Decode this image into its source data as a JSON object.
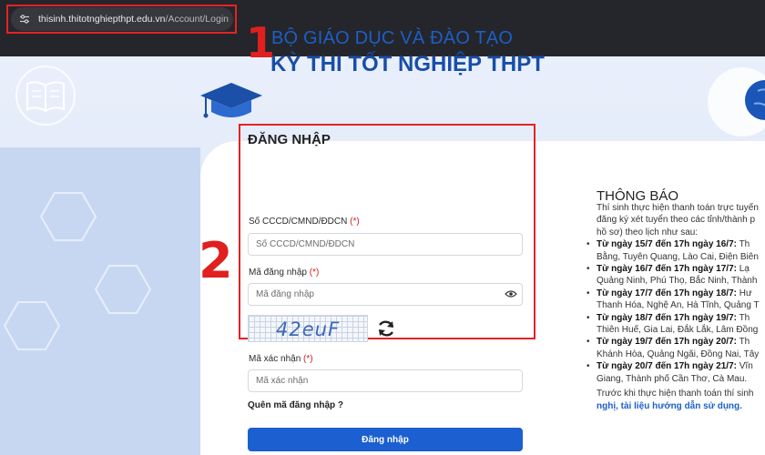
{
  "browser": {
    "url_host": "thisinh.thitotnghiepthpt.edu.vn",
    "url_path": "/Account/Login"
  },
  "annotations": {
    "step1": "1",
    "step2": "2"
  },
  "header": {
    "ministry": "BỘ GIÁO DỤC VÀ ĐÀO TẠO",
    "exam": "KỲ THI TỐT NGHIỆP THPT"
  },
  "login": {
    "title": "ĐĂNG NHẬP",
    "required_mark": "(*)",
    "id_label": "Số CCCD/CMND/ĐDCN",
    "id_placeholder": "Số CCCD/CMND/ĐDCN",
    "code_label": "Mã đăng nhập",
    "code_placeholder": "Mã đăng nhập",
    "captcha_text": "42euF",
    "captcha_label": "Mã xác nhận",
    "captcha_placeholder": "Mã xác nhận",
    "forgot": "Quên mã đăng nhập ?",
    "submit": "Đăng nhập"
  },
  "notice": {
    "title": "THÔNG BÁO",
    "intro": [
      "Thí sinh thực hiện thanh toán trực tuyến",
      "đăng ký xét tuyển theo các tỉnh/thành p",
      "hồ sơ) theo lịch như sau:"
    ],
    "items": [
      {
        "date": "Từ ngày 15/7 đến 17h ngày 16/7:",
        "rest": " Th",
        "line2": "Bằng, Tuyên Quang, Lào Cai, Điện Biên"
      },
      {
        "date": "Từ ngày 16/7 đến 17h ngày 17/7:",
        "rest": " Lạ",
        "line2": "Quảng Ninh, Phú Thọ, Bắc Ninh, Thành"
      },
      {
        "date": "Từ ngày 17/7 đến 17h ngày 18/7:",
        "rest": " Hư",
        "line2": "Thanh Hóa, Nghệ An, Hà Tĩnh, Quảng T"
      },
      {
        "date": "Từ ngày 18/7 đến 17h ngày 19/7:",
        "rest": " Th",
        "line2": "Thiên Huế, Gia Lai, Đắk Lắk, Lâm Đồng"
      },
      {
        "date": "Từ ngày 19/7 đến 17h ngày 20/7:",
        "rest": " Th",
        "line2": "Khánh Hòa, Quảng Ngãi, Đồng Nai, Tây"
      },
      {
        "date": "Từ ngày 20/7 đến 17h ngày 21/7:",
        "rest": " Vĩn",
        "line2": "Giang, Thành phố Cần Thơ, Cà Mau."
      }
    ],
    "footer": "Trước khi thực hiện thanh toán thí sinh",
    "link": "nghị, tài liệu hướng dẫn sử dụng."
  }
}
